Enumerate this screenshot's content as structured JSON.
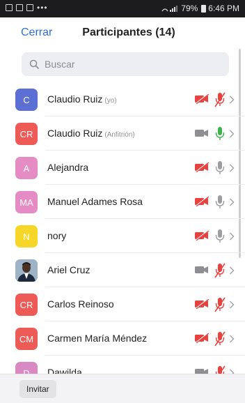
{
  "status_bar": {
    "signal_text": "•••",
    "battery": "79%",
    "time": "6:46 PM"
  },
  "header": {
    "close_label": "Cerrar",
    "title": "Participantes (14)"
  },
  "search": {
    "placeholder": "Buscar"
  },
  "participants": [
    {
      "initials": "C",
      "name": "Claudio  Ruiz",
      "tag": "(yo)",
      "avatar_color": "#5b6fd4",
      "video_off": true,
      "mic": "muted"
    },
    {
      "initials": "CR",
      "name": "Claudio Ruiz",
      "tag": "(Anfitrión)",
      "avatar_color": "#ee5b57",
      "video_off": false,
      "mic": "active"
    },
    {
      "initials": "A",
      "name": "Alejandra",
      "tag": "",
      "avatar_color": "#e58cc4",
      "video_off": true,
      "mic": "on"
    },
    {
      "initials": "MA",
      "name": "Manuel Adames Rosa",
      "tag": "",
      "avatar_color": "#e58cc4",
      "video_off": true,
      "mic": "on"
    },
    {
      "initials": "N",
      "name": "nory",
      "tag": "",
      "avatar_color": "#f6d629",
      "video_off": true,
      "mic": "on"
    },
    {
      "initials": "",
      "name": "Ariel Cruz",
      "tag": "",
      "avatar_color": "#8aa0b4",
      "video_off": false,
      "mic": "muted",
      "photo": true
    },
    {
      "initials": "CR",
      "name": "Carlos Reinoso",
      "tag": "",
      "avatar_color": "#ee5b57",
      "video_off": true,
      "mic": "muted"
    },
    {
      "initials": "CM",
      "name": "Carmen María Méndez",
      "tag": "",
      "avatar_color": "#ee5b57",
      "video_off": true,
      "mic": "muted"
    },
    {
      "initials": "D",
      "name": "Dawilda",
      "tag": "",
      "avatar_color": "#d98ac3",
      "video_off": false,
      "mic": "muted"
    }
  ],
  "footer": {
    "invite_label": "Invitar"
  },
  "colors": {
    "accent": "#2d6fde",
    "muted_red": "#e8423f",
    "mic_active": "#3ab54a",
    "icon_gray": "#8e8e93"
  }
}
